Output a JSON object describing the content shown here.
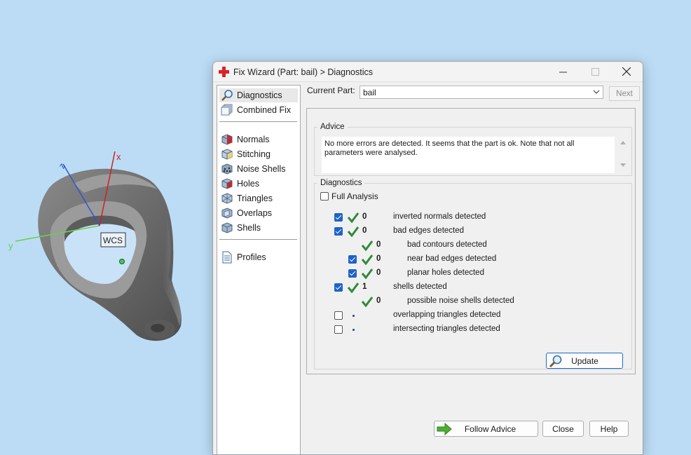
{
  "viewport": {
    "wcs_label": "WCS",
    "axis_x": "x",
    "axis_y": "y",
    "axis_z": "z"
  },
  "window": {
    "title": "Fix Wizard (Part: bail) > Diagnostics"
  },
  "nav": {
    "items": [
      {
        "label": "Diagnostics",
        "icon": "magnifier-icon",
        "selected": true
      },
      {
        "label": "Combined Fix",
        "icon": "stack-icon"
      },
      {
        "label": "Normals",
        "icon": "cube-red-icon"
      },
      {
        "label": "Stitching",
        "icon": "cube-stitch-icon"
      },
      {
        "label": "Noise Shells",
        "icon": "cube-dots-icon"
      },
      {
        "label": "Holes",
        "icon": "cube-hole-icon"
      },
      {
        "label": "Triangles",
        "icon": "cube-tri-icon"
      },
      {
        "label": "Overlaps",
        "icon": "cube-overlap-icon"
      },
      {
        "label": "Shells",
        "icon": "cube-shell-icon"
      },
      {
        "label": "Profiles",
        "icon": "document-icon"
      }
    ]
  },
  "part": {
    "label": "Current Part:",
    "value": "bail",
    "next_label": "Next"
  },
  "advice": {
    "legend": "Advice",
    "text": "No more errors are detected. It seems that the part is ok. Note that not all parameters were analysed."
  },
  "diagnostics": {
    "legend": "Diagnostics",
    "full_analysis_label": "Full Analysis",
    "rows": [
      {
        "checked": true,
        "status": "ok",
        "count": "0",
        "label": "inverted normals detected"
      },
      {
        "checked": true,
        "status": "ok",
        "count": "0",
        "label": "bad edges detected"
      },
      {
        "checked": null,
        "status": "ok",
        "count": "0",
        "label": "bad contours detected"
      },
      {
        "checked": true,
        "status": "ok",
        "count": "0",
        "label": "near bad edges detected"
      },
      {
        "checked": true,
        "status": "ok",
        "count": "0",
        "label": "planar holes detected"
      },
      {
        "checked": true,
        "status": "ok",
        "count": "1",
        "label": "shells detected"
      },
      {
        "checked": null,
        "status": "ok",
        "count": "0",
        "label": "possible noise shells detected"
      },
      {
        "checked": false,
        "status": "pending",
        "count": "",
        "label": "overlapping triangles detected"
      },
      {
        "checked": false,
        "status": "pending",
        "count": "",
        "label": "intersecting triangles detected"
      }
    ],
    "update_label": "Update"
  },
  "footer": {
    "follow_label": "Follow Advice",
    "close_label": "Close",
    "help_label": "Help"
  },
  "colors": {
    "accent": "#1d63c9",
    "ok": "#2e8b3a",
    "background": "#bcdcf5"
  }
}
